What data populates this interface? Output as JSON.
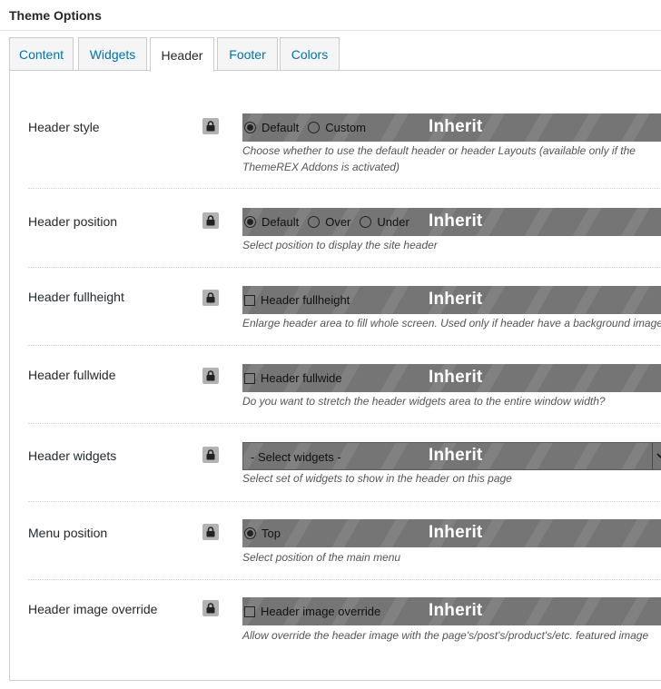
{
  "header": {
    "title": "Theme Options"
  },
  "tabs": [
    {
      "label": "Content",
      "active": false
    },
    {
      "label": "Widgets",
      "active": false
    },
    {
      "label": "Header",
      "active": true
    },
    {
      "label": "Footer",
      "active": false
    },
    {
      "label": "Colors",
      "active": false
    }
  ],
  "inherit_label": "Inherit",
  "options": {
    "header_style": {
      "label": "Header style",
      "choices": [
        "Default",
        "Custom"
      ],
      "selected": "Default",
      "description": "Choose whether to use the default header or header Layouts (available only if the ThemeREX Addons is activated)"
    },
    "header_position": {
      "label": "Header position",
      "choices": [
        "Default",
        "Over",
        "Under"
      ],
      "selected": "Default",
      "description": "Select position to display the site header"
    },
    "header_fullheight": {
      "label": "Header fullheight",
      "checkbox_label": "Header fullheight",
      "checked": false,
      "description": "Enlarge header area to fill whole screen. Used only if header have a background image"
    },
    "header_fullwide": {
      "label": "Header fullwide",
      "checkbox_label": "Header fullwide",
      "checked": false,
      "description": "Do you want to stretch the header widgets area to the entire window width?"
    },
    "header_widgets": {
      "label": "Header widgets",
      "selected": "- Select widgets -",
      "description": "Select set of widgets to show in the header on this page"
    },
    "menu_position": {
      "label": "Menu position",
      "choices": [
        "Top"
      ],
      "selected": "Top",
      "description": "Select position of the main menu"
    },
    "header_image_override": {
      "label": "Header image override",
      "checkbox_label": "Header image override",
      "checked": false,
      "description": "Allow override the header image with the page's/post's/product's/etc. featured image"
    }
  },
  "colors": {
    "tab_link": "#0073aa",
    "inherit_overlay": "#757575",
    "lock_icon_bg": "#b3b3b3"
  }
}
